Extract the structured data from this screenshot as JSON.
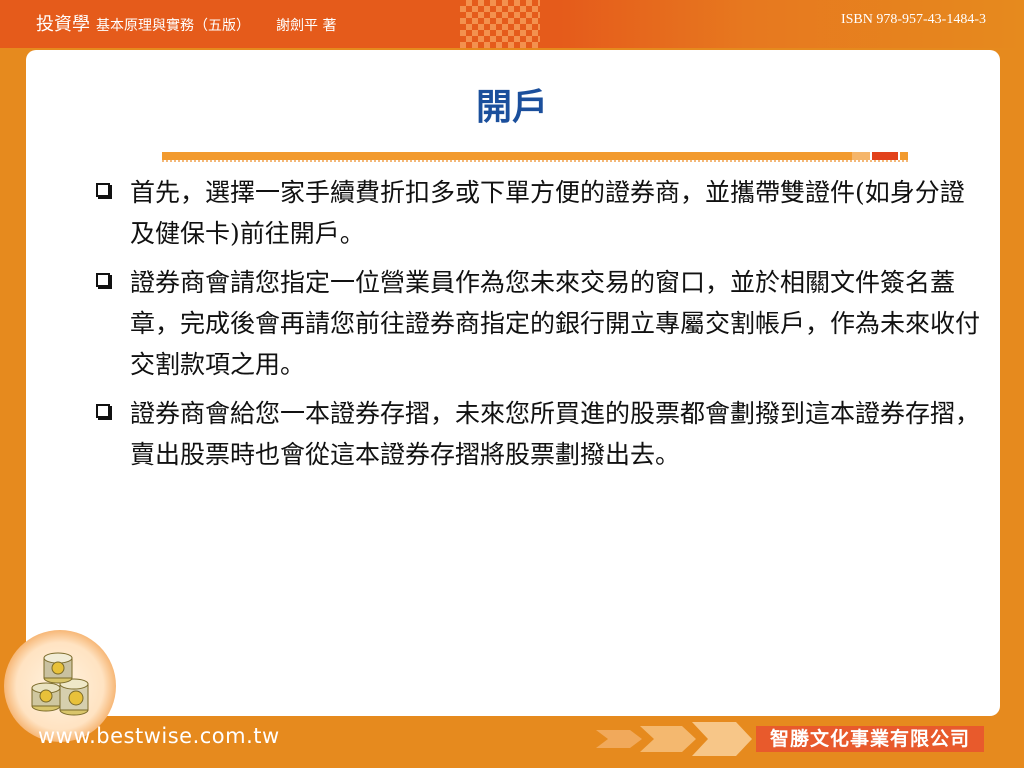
{
  "header": {
    "book_title": "投資學",
    "subtitle": "基本原理與實務（五版）",
    "author": "謝劍平 著",
    "isbn": "ISBN 978-957-43-1484-3"
  },
  "slide": {
    "title": "開戶",
    "bullets": [
      "首先，選擇一家手續費折扣多或下單方便的證券商，並攜帶雙證件(如身分證及健保卡)前往開戶。",
      "證券商會請您指定一位營業員作為您未來交易的窗口，並於相關文件簽名蓋章，完成後會再請您前往證券商指定的銀行開立專屬交割帳戶，作為未來收付交割款項之用。",
      "證券商會給您一本證券存摺，未來您所買進的股票都會劃撥到這本證券存摺，賣出股票時也會從這本證券存摺將股票劃撥出去。"
    ],
    "bullet_icon": "square-checkbox-icon"
  },
  "footer": {
    "url": "www.bestwise.com.tw",
    "publisher": "智勝文化事業有限公司",
    "emblem_icon": "coin-stack-icon",
    "arrows_icon": "arrows-icon"
  },
  "colors": {
    "title_blue": "#1b4f9c",
    "brand_orange": "#e68a1e",
    "header_red_orange": "#e55b1b",
    "publisher_red": "#e85a2c"
  }
}
